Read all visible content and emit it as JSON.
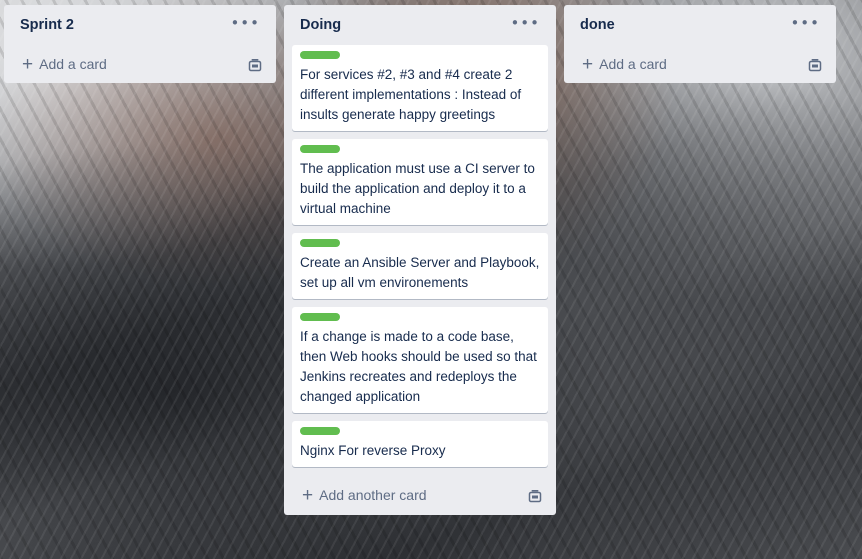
{
  "lists": [
    {
      "title": "Sprint 2",
      "menu_icon": "ellipsis-icon",
      "add_label": "Add a card",
      "cards": []
    },
    {
      "title": "Doing",
      "menu_icon": "ellipsis-icon",
      "add_label": "Add another card",
      "cards": [
        {
          "label_color": "#61bd4f",
          "text": "For services #2, #3 and #4 create 2 different implementations : Instead of insults generate happy greetings"
        },
        {
          "label_color": "#61bd4f",
          "text": "The application must use a CI server to build the application and deploy it to a virtual machine"
        },
        {
          "label_color": "#61bd4f",
          "text": "Create an Ansible Server and Playbook, set up all vm environements"
        },
        {
          "label_color": "#61bd4f",
          "text": "If a change is made to a code base, then Web hooks should be used so that Jenkins recreates and redeploys the changed application"
        },
        {
          "label_color": "#61bd4f",
          "text": "Nginx For reverse Proxy"
        }
      ]
    },
    {
      "title": "done",
      "menu_icon": "ellipsis-icon",
      "add_label": "Add a card",
      "cards": []
    }
  ],
  "colors": {
    "list_bg": "#ebecf0",
    "label_green": "#61bd4f",
    "text": "#172b4d",
    "muted": "#5e6c84"
  }
}
